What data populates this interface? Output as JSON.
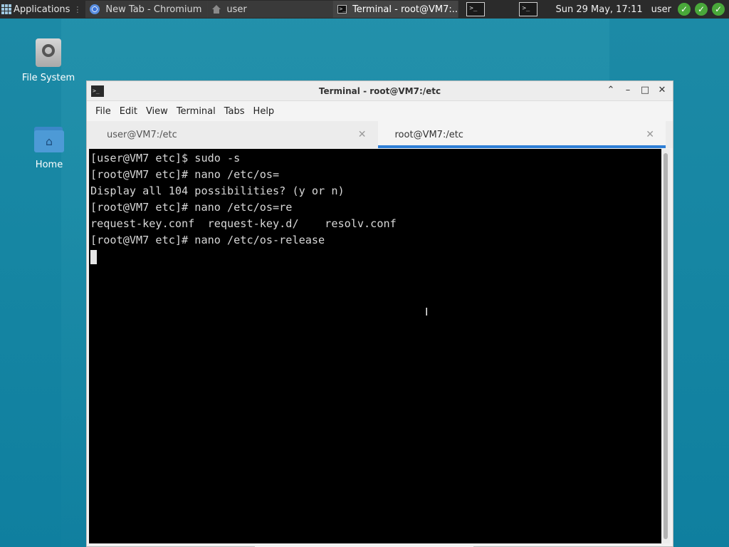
{
  "panel": {
    "applications_label": "Applications",
    "tasks": [
      {
        "label": "New Tab - Chromium",
        "icon": "chromium-icon"
      },
      {
        "label": "user",
        "icon": "home-icon"
      },
      {
        "label": "Terminal - root@VM7:...",
        "icon": "terminal-icon"
      }
    ],
    "clock": "Sun 29 May, 17:11",
    "user": "user"
  },
  "desktop": {
    "icons": [
      {
        "label": "File System"
      },
      {
        "label": "Home"
      }
    ]
  },
  "window": {
    "title": "Terminal - root@VM7:/etc",
    "menu": [
      "File",
      "Edit",
      "View",
      "Terminal",
      "Tabs",
      "Help"
    ],
    "tabs": [
      {
        "label": "user@VM7:/etc",
        "active": false
      },
      {
        "label": "root@VM7:/etc",
        "active": true
      }
    ]
  },
  "terminal": {
    "lines": [
      "[user@VM7 etc]$ sudo -s",
      "[root@VM7 etc]# nano /etc/os=",
      "Display all 104 possibilities? (y or n)",
      "[root@VM7 etc]# nano /etc/os=re",
      "request-key.conf  request-key.d/    resolv.conf",
      "[root@VM7 etc]# nano /etc/os-release"
    ]
  },
  "colors": {
    "accent": "#2f7fd6",
    "terminal_bg": "#000000",
    "status_ok": "#49a83a"
  }
}
